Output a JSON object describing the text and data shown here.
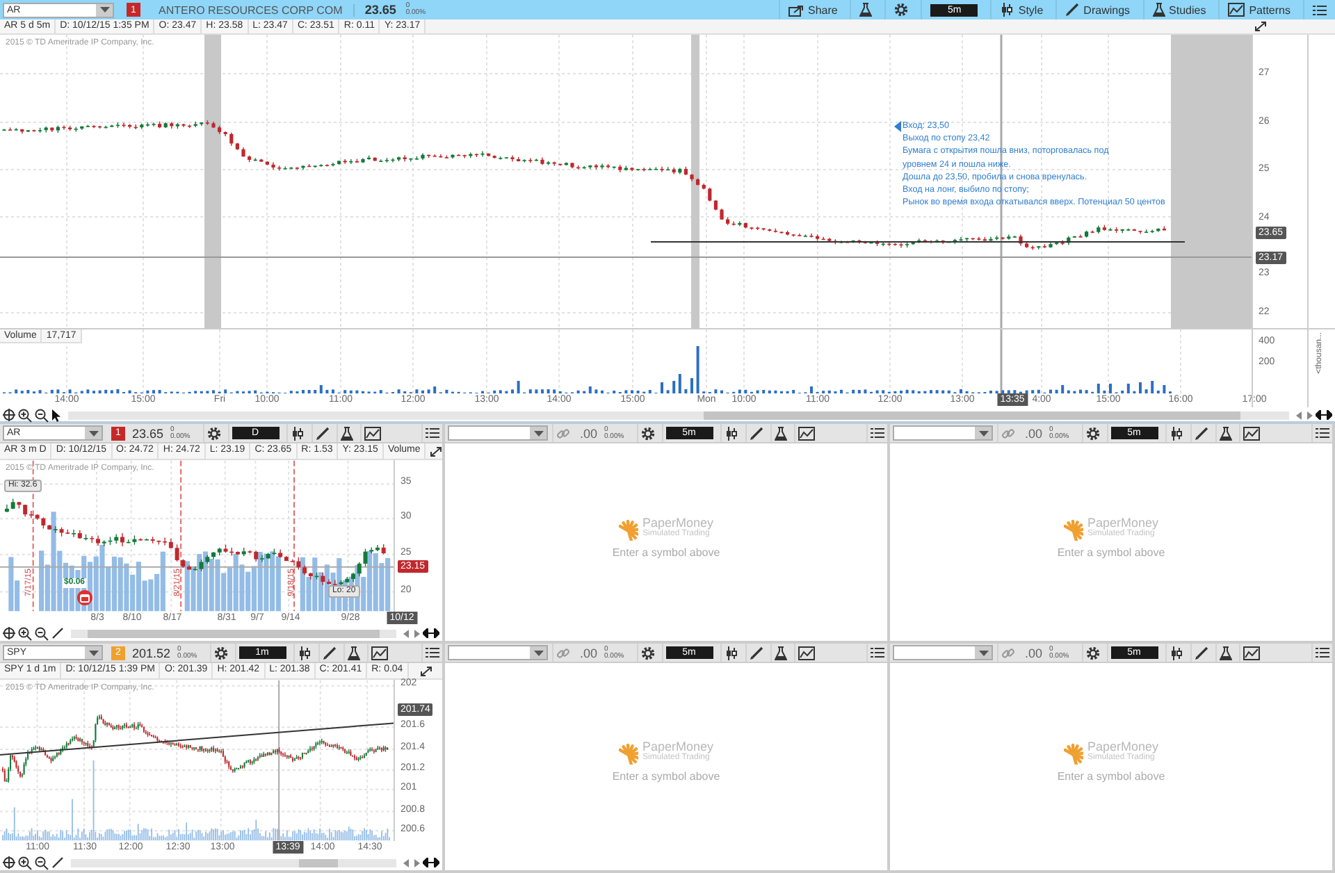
{
  "main_chart": {
    "symbol": "AR",
    "alert": "1",
    "company": "ANTERO RESOURCES CORP COM",
    "price": "23.65",
    "change": "0",
    "change_pct": "0.00%",
    "tools": [
      {
        "kind": "share",
        "label": "Share"
      },
      {
        "kind": "beaker"
      },
      {
        "kind": "gear"
      },
      {
        "kind": "timeframe",
        "label": "5m"
      },
      {
        "kind": "style",
        "label": "Style"
      },
      {
        "kind": "pencil",
        "label": "Drawings"
      },
      {
        "kind": "studies",
        "label": "Studies"
      },
      {
        "kind": "patterns",
        "label": "Patterns"
      },
      {
        "kind": "menu"
      }
    ],
    "info": [
      "AR 5 d 5m",
      "D: 10/12/15 1:35 PM",
      "O: 23.47",
      "H: 23.58",
      "L: 23.47",
      "C: 23.51",
      "R: 0.11",
      "Y: 23.17"
    ],
    "copyright": "2015 © TD Ameritrade IP Company, Inc.",
    "price_axis": [
      "27",
      "26",
      "25",
      "24",
      "23",
      "22"
    ],
    "price_badges": [
      "23.65",
      "23.17"
    ],
    "note": [
      "Вход: 23,50",
      "Выход по стопу 23,42",
      "Бумага с открытия пошла вниз, поторговалась под",
      "уровнем 24 и пошла ниже.",
      "Дошла до 23,50, пробила и снова вренулась.",
      "Вход на лонг, выбило по стопу;",
      "Рынок во время входа откатывался вверх. Потенциал 50 центов"
    ],
    "volume_label": "Volume",
    "volume_value": "17,717",
    "volume_axis": [
      "400",
      "200"
    ],
    "volume_unit": "<thousan...",
    "time_axis": [
      "14:00",
      "15:00",
      "Fri",
      "10:00",
      "11:00",
      "12:00",
      "13:00",
      "14:00",
      "15:00",
      "Mon",
      "10:00",
      "11:00",
      "12:00",
      "13:00",
      "4:00",
      "15:00",
      "16:00",
      "17:00"
    ],
    "cursor_time": "13:35"
  },
  "small_panels": [
    {
      "kind": "chart",
      "symbol": "AR",
      "alert": {
        "label": "1",
        "color": "#c62828"
      },
      "price": "23.65",
      "change": "0",
      "change_pct": "0.00%",
      "timeframe": "D",
      "info": [
        "AR 3 m D",
        "D: 10/12/15",
        "O: 24.72",
        "H: 24.72",
        "L: 23.19",
        "C: 23.65",
        "R: 1.53",
        "Y: 23.15",
        "Volume"
      ],
      "copyright": "2015 © TD Ameritrade IP Company, Inc.",
      "price_axis": [
        "35",
        "30",
        "25",
        "20"
      ],
      "price_badge": "23.15",
      "high": "Hi: 32.6",
      "low": "Lo: 20",
      "dividend": "$0.06",
      "events": [
        "7/17/15",
        "8/21/15",
        "9/18/15"
      ],
      "time_axis": [
        "8/3",
        "8/10",
        "8/17",
        "8/31",
        "9/7",
        "9/14",
        "9/28"
      ],
      "cursor_time": "10/12"
    },
    {
      "kind": "empty",
      "price": ".00",
      "change": "0",
      "change_pct": "0.00%",
      "timeframe": "5m",
      "brand": "PaperMoney",
      "brand_sub": "Simulated Trading",
      "prompt": "Enter a symbol above"
    },
    {
      "kind": "empty",
      "price": ".00",
      "change": "0",
      "change_pct": "0.00%",
      "timeframe": "5m",
      "brand": "PaperMoney",
      "brand_sub": "Simulated Trading",
      "prompt": "Enter a symbol above"
    },
    {
      "kind": "chart",
      "symbol": "SPY",
      "alert": {
        "label": "2",
        "color": "#f0a030"
      },
      "price": "201.52",
      "change": "0",
      "change_pct": "0.00%",
      "timeframe": "1m",
      "info": [
        "SPY 1 d 1m",
        "D: 10/12/15 1:39 PM",
        "O: 201.39",
        "H: 201.42",
        "L: 201.38",
        "C: 201.41",
        "R: 0.04"
      ],
      "copyright": "2015 © TD Ameritrade IP Company, Inc.",
      "price_axis": [
        "202",
        "201.6",
        "201.4",
        "201.2",
        "201",
        "200.8",
        "200.6"
      ],
      "price_badge": "201.74",
      "time_axis": [
        "11:00",
        "11:30",
        "12:00",
        "12:30",
        "13:00",
        "14:00",
        "14:30"
      ],
      "cursor_time": "13:39"
    },
    {
      "kind": "empty",
      "price": ".00",
      "change": "0",
      "change_pct": "0.00%",
      "timeframe": "5m",
      "brand": "PaperMoney",
      "brand_sub": "Simulated Trading",
      "prompt": "Enter a symbol above"
    },
    {
      "kind": "empty",
      "price": ".00",
      "change": "0",
      "change_pct": "0.00%",
      "timeframe": "5m",
      "brand": "PaperMoney",
      "brand_sub": "Simulated Trading",
      "prompt": "Enter a symbol above"
    }
  ]
}
